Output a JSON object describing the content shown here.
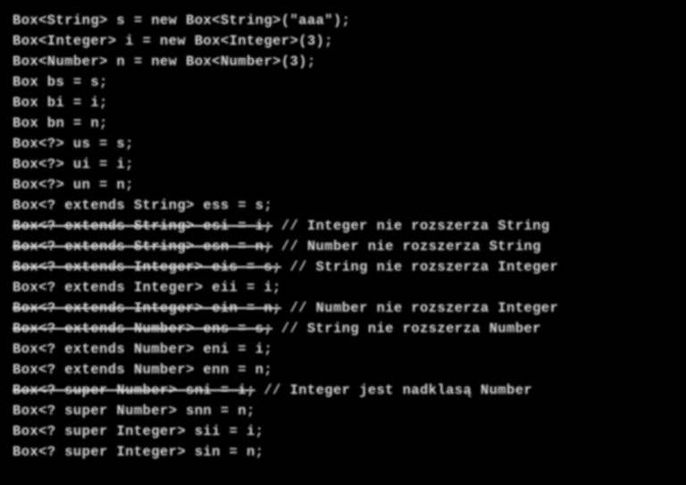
{
  "code": {
    "lines": [
      {
        "type": "plain",
        "text": "Box<String> s = new Box<String>(\"aaa\");"
      },
      {
        "type": "plain",
        "text": "Box<Integer> i = new Box<Integer>(3);"
      },
      {
        "type": "plain",
        "text": "Box<Number> n = new Box<Number>(3);"
      },
      {
        "type": "plain",
        "text": "Box bs = s;"
      },
      {
        "type": "plain",
        "text": "Box bi = i;"
      },
      {
        "type": "plain",
        "text": "Box bn = n;"
      },
      {
        "type": "plain",
        "text": "Box<?> us = s;"
      },
      {
        "type": "plain",
        "text": "Box<?> ui = i;"
      },
      {
        "type": "plain",
        "text": "Box<?> un = n;"
      },
      {
        "type": "plain",
        "text": "Box<? extends String> ess = s;"
      },
      {
        "type": "strike",
        "strike": "Box<? extends String> esi = i;",
        "tail": " // Integer nie rozszerza String"
      },
      {
        "type": "strike",
        "strike": "Box<? extends String> esn = n;",
        "tail": " // Number nie rozszerza String"
      },
      {
        "type": "strike",
        "strike": "Box<? extends Integer> eis = s;",
        "tail": " // String nie rozszerza Integer"
      },
      {
        "type": "plain",
        "text": "Box<? extends Integer> eii = i;"
      },
      {
        "type": "strike",
        "strike": "Box<? extends Integer> ein = n;",
        "tail": " // Number nie rozszerza Integer"
      },
      {
        "type": "strike",
        "strike": "Box<? extends Number> ens = s;",
        "tail": " // String nie rozszerza Number"
      },
      {
        "type": "plain",
        "text": "Box<? extends Number> eni = i;"
      },
      {
        "type": "plain",
        "text": "Box<? extends Number> enn = n;"
      },
      {
        "type": "strike",
        "strike": "Box<? super Number> sni = i;",
        "tail": " // Integer jest nadklasą Number"
      },
      {
        "type": "plain",
        "text": "Box<? super Number> snn = n;"
      },
      {
        "type": "plain",
        "text": "Box<? super Integer> sii = i;"
      },
      {
        "type": "plain",
        "text": "Box<? super Integer> sin = n;"
      }
    ]
  }
}
